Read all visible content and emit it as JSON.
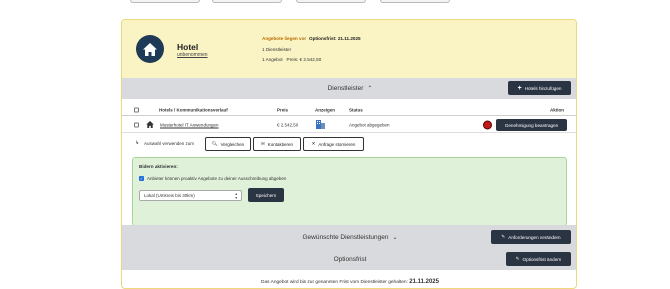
{
  "hotel": {
    "name": "Hotel",
    "status": "unbenommen",
    "offer_status_label": "Angebote liegen vor",
    "deadline_label": "Optionsfrist: 21.11.2025",
    "provider_count": "1 Dienstleister",
    "offer_summary": "1 Angebot   Preis: € 2.542,50"
  },
  "sections": {
    "providers": {
      "title": "Dienstleister",
      "chevron": "⌃",
      "button": "Hotels hinzufügen"
    },
    "services": {
      "title": "Gewünschte Dienstleistungen",
      "chevron": "⌄",
      "button": "Anforderungen verändern"
    },
    "option": {
      "title": "Optionsfrist",
      "button": "Optionsfrist ändern"
    }
  },
  "table": {
    "headers": [
      "Hotels / Kommunikationsverlauf",
      "Preis",
      "Anzeigen",
      "Status",
      "Aktion"
    ],
    "rows": [
      {
        "name": "Musterhotel IT Anwendungen",
        "price": "€ 2.542,50",
        "status": "Angebot abgegeben",
        "action": "Genehmigung beantragen"
      }
    ]
  },
  "bulk": {
    "label": "Auswahl verwenden zum",
    "compare": "Vergleichen",
    "contact": "Kontaktieren",
    "cancel": "Anfrage stornieren"
  },
  "bidding": {
    "title": "Bidern aktivieren:",
    "checkbox_label": "Anbieter können proaktiv Angebote zu deiner Ausschreibung abgeben",
    "select_value": "Lokal (Umkreis bis 30km)",
    "save": "Speichern"
  },
  "extended": "Erweiterte Funktionen",
  "footer": {
    "text": "Das Angebot wird bis zur genannten Frist vom Dienstleister gehalten:",
    "date": "21.11.2025"
  },
  "colors": {
    "header_bg": "#faf3c4",
    "section_bg": "#d9dadd",
    "dark_button": "#2a3442",
    "bid_box": "#dff1d8",
    "status_orange": "#b86e00",
    "record_red": "#c0191b"
  }
}
